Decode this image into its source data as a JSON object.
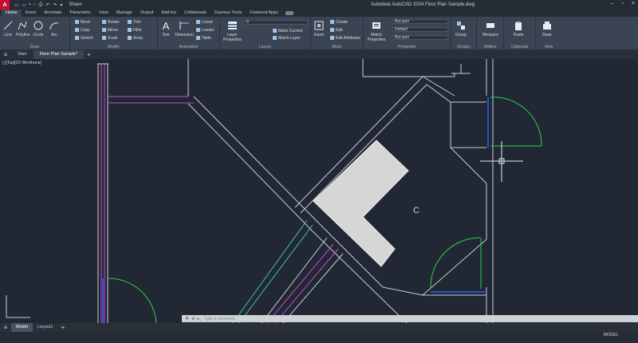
{
  "app": {
    "title": "Autodesk AutoCAD 2024    Floor Plan Sample.dwg",
    "logo_letter": "A",
    "share_label": "Share"
  },
  "ribbon_tabs": [
    "Home",
    "Insert",
    "Annotate",
    "Parametric",
    "View",
    "Manage",
    "Output",
    "Add-ins",
    "Collaborate",
    "Express Tools",
    "Featured Apps"
  ],
  "ribbon": {
    "draw_title": "Draw",
    "modify_title": "Modify",
    "annotation_title": "Annotation",
    "layers_title": "Layers",
    "block_title": "Block",
    "properties_title": "Properties",
    "groups_title": "Groups",
    "utilities_title": "Utilities",
    "clipboard_title": "Clipboard",
    "view_title": "View",
    "draw_tools": [
      "Line",
      "Polyline",
      "Circle",
      "Arc"
    ],
    "modify_tools": [
      "Move",
      "Rotate",
      "Trim",
      "Copy",
      "Mirror",
      "Fillet",
      "Stretch",
      "Scale",
      "Array"
    ],
    "text_label": "Text",
    "dimension_label": "Dimension",
    "annotation_small": [
      "Linear",
      "Leader",
      "Table"
    ],
    "layer_properties_label": "Layer Properties",
    "layer_value": "0",
    "layer_small": [
      "Make Current",
      "Match Layer"
    ],
    "insert_label": "Insert",
    "block_small": [
      "Create",
      "Edit",
      "Edit Attributes"
    ],
    "match_properties_label": "Match Properties",
    "bylayer_1": "ByLayer",
    "bylayer_2": "Default",
    "bylayer_3": "ByLayer",
    "group_label": "Group",
    "measure_label": "Measure",
    "paste_label": "Paste",
    "base_label": "Base"
  },
  "doc_tabs": {
    "start": "Start",
    "active": "Floor Plan Sample*"
  },
  "canvas": {
    "view_label": "[-][Top][2D Wireframe]",
    "cursor_letter": "C"
  },
  "command": {
    "prompt": "Type a command"
  },
  "layout_tabs": [
    "Model",
    "Layout1"
  ],
  "status": {
    "model": "MODEL"
  },
  "colors": {
    "background": "#212833",
    "walls": "#c9ced6",
    "magenta": "#c44bd3",
    "green": "#2fcf4a",
    "blue": "#2b4fd8",
    "teal": "#3fbfa8",
    "furniture": "#d6d6d6"
  }
}
